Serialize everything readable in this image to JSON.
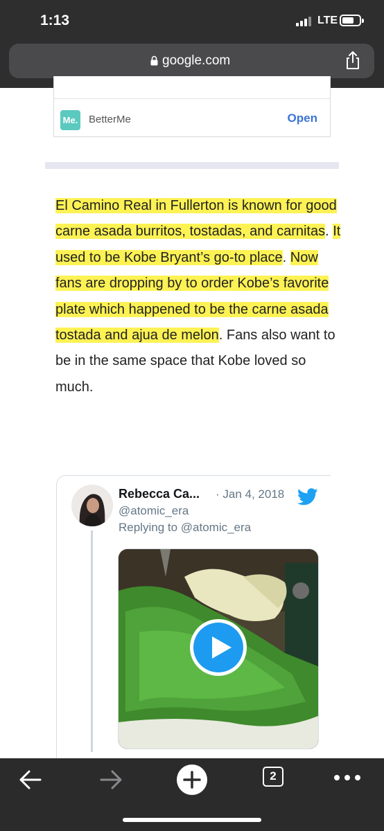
{
  "status_bar": {
    "time": "1:13",
    "network": "LTE"
  },
  "browser": {
    "url": "google.com"
  },
  "ad": {
    "logo_text": "Me.",
    "name": "BetterMe",
    "open_label": "Open"
  },
  "article": {
    "segments": [
      {
        "text": "El Camino Real in Fullerton is known for good carne asada burritos, tostadas, and carnitas",
        "highlight": true
      },
      {
        "text": ". ",
        "highlight": false
      },
      {
        "text": "It used to be Kobe Bryant’s go-to place",
        "highlight": true
      },
      {
        "text": ". ",
        "highlight": false
      },
      {
        "text": "Now fans are dropping by to order Kobe’s favorite plate which happened to be the carne asada tostada and ajua de melon",
        "highlight": true
      },
      {
        "text": ". Fans also want to be in the same space that Kobe loved so much.",
        "highlight": false
      }
    ]
  },
  "tweet": {
    "author_name": "Rebecca Ca...",
    "date": "· Jan 4, 2018",
    "handle": "@atomic_era",
    "replying_to": "Replying to @atomic_era"
  },
  "toolbar": {
    "tab_count": "2"
  },
  "colors": {
    "highlight": "#fdf254",
    "link_blue": "#3b73d6",
    "twitter_blue": "#1da1f2",
    "ad_logo": "#5cc9bf"
  }
}
